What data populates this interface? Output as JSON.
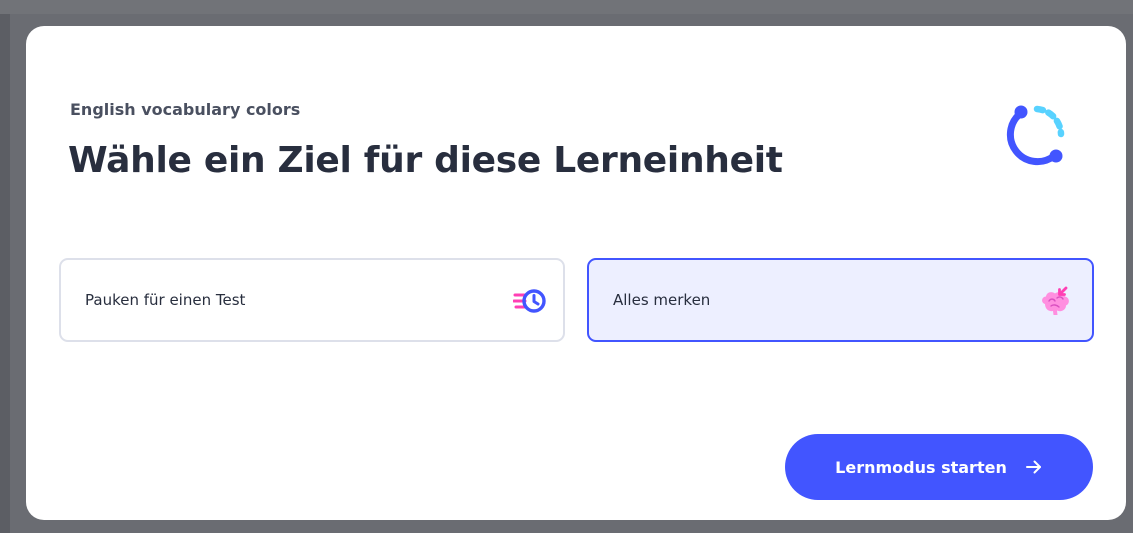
{
  "dialog": {
    "subtitle": "English vocabulary colors",
    "title": "Wähle ein Ziel für diese Lerneinheit",
    "logo_icon": "progress-ring-logo-icon",
    "options": [
      {
        "label": "Pauken für einen Test",
        "icon": "fast-clock-icon",
        "selected": false
      },
      {
        "label": "Alles merken",
        "icon": "brain-icon",
        "selected": true
      }
    ],
    "start_button": {
      "label": "Lernmodus starten",
      "icon": "arrow-right-icon"
    }
  },
  "colors": {
    "accent": "#4255ff",
    "selected_background": "#edefff",
    "title_text": "#282e3e",
    "backdrop": "#6a6c72",
    "icon_pink": "#ff3fb4",
    "icon_light_blue": "#58d2ff"
  }
}
